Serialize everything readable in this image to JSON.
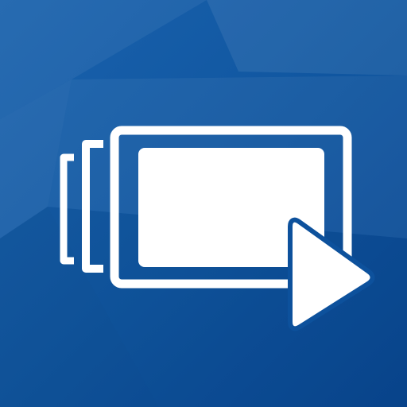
{
  "icon": {
    "name": "slideshow-play-app-icon",
    "glyphs": [
      "stacked-frames-icon",
      "play-icon"
    ]
  },
  "colors": {
    "background_dark": "#0a4a93",
    "background_mid": "#11589f",
    "background_light": "#2a72b8",
    "foreground": "#ffffff"
  }
}
